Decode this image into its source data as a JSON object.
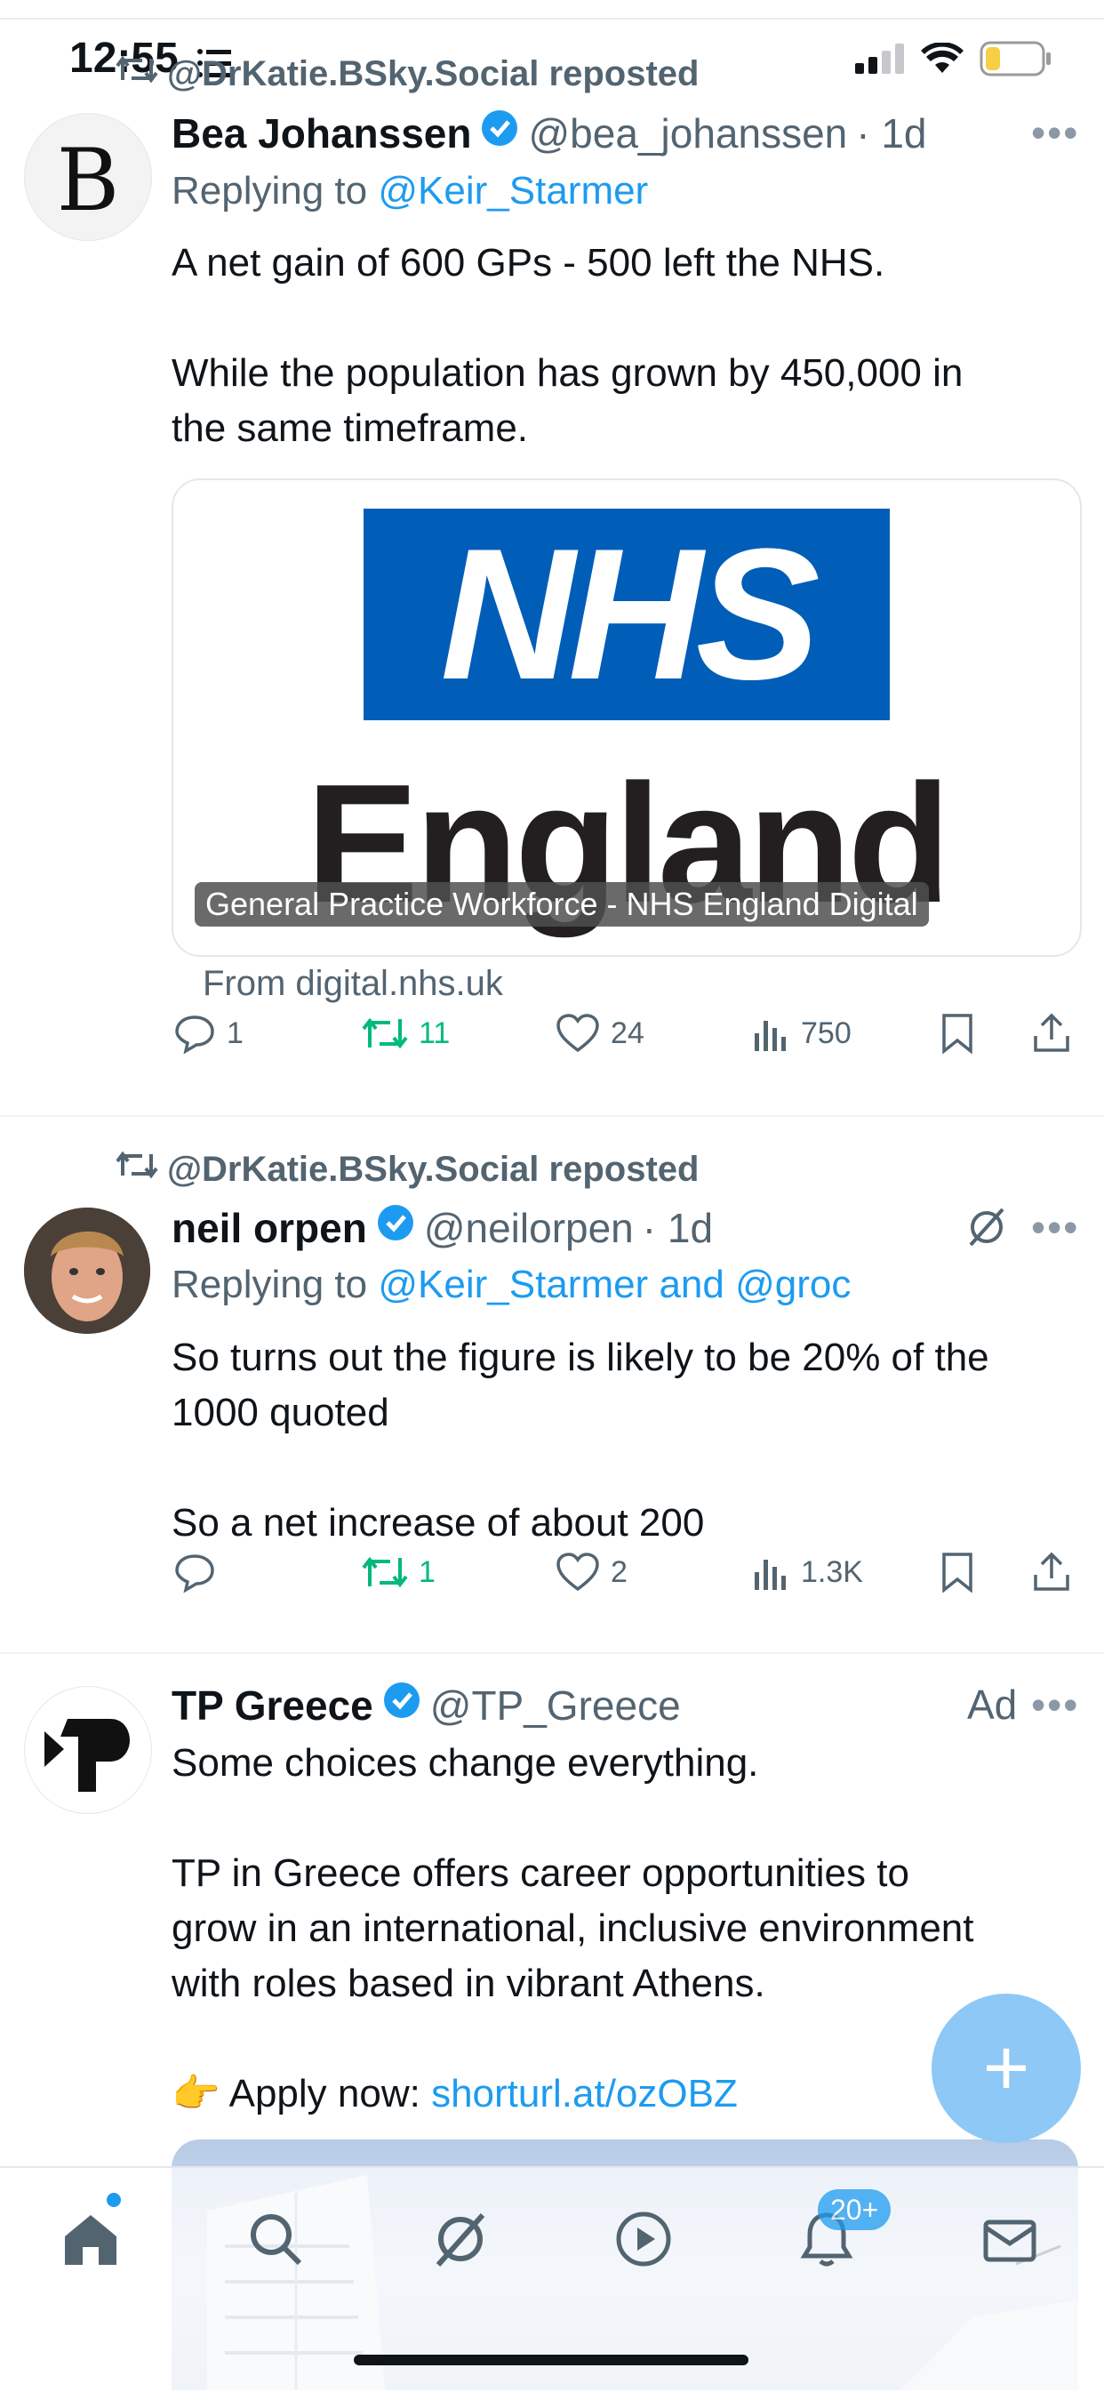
{
  "status_bar": {
    "time": "12:55"
  },
  "tweets": [
    {
      "repost_by": "@DrKatie.BSky.Social reposted",
      "name": "Bea Johanssen",
      "handle": "@bea_johanssen",
      "time": "· 1d",
      "replying_prefix": "Replying to ",
      "replying_to": "@Keir_Starmer",
      "text_line1": "A net gain of 600 GPs -  500 left the NHS.",
      "text_line2": "While the population has grown by 450,000 in",
      "text_line3": "the same timeframe.",
      "card": {
        "logo_top": "NHS",
        "logo_bottom": "England",
        "caption": "General Practice Workforce - NHS England Digital",
        "from": "From digital.nhs.uk"
      },
      "stats": {
        "replies": "1",
        "reposts": "11",
        "likes": "24",
        "views": "750"
      }
    },
    {
      "repost_by": "@DrKatie.BSky.Social reposted",
      "name": "neil orpen",
      "handle": "@neilorpen",
      "time": "· 1d",
      "replying_prefix": "Replying to ",
      "replying_to": "@Keir_Starmer and @groc",
      "text_line1": "So turns out the figure is likely to be 20% of the",
      "text_line2": "1000 quoted",
      "text_line3": "So a net increase of about 200",
      "stats": {
        "replies": "",
        "reposts": "1",
        "likes": "2",
        "views": "1.3K"
      }
    },
    {
      "name": "TP Greece",
      "handle": "@TP_Greece",
      "ad_label": "Ad",
      "text_line1": "Some choices change everything.",
      "text_line2": "TP in Greece offers career opportunities to",
      "text_line3": "grow in an international, inclusive environment",
      "text_line4": "with roles based in vibrant Athens.",
      "apply_emoji": "👉",
      "apply_prefix": "Apply now: ",
      "apply_link": "shorturl.at/ozOBZ"
    }
  ],
  "fab": {
    "label": "+"
  },
  "tabbar": {
    "notifications_badge": "20+"
  },
  "colors": {
    "accent": "#1d9bf0",
    "repost_green": "#00ba7c",
    "nhs_blue": "#005eb8"
  }
}
